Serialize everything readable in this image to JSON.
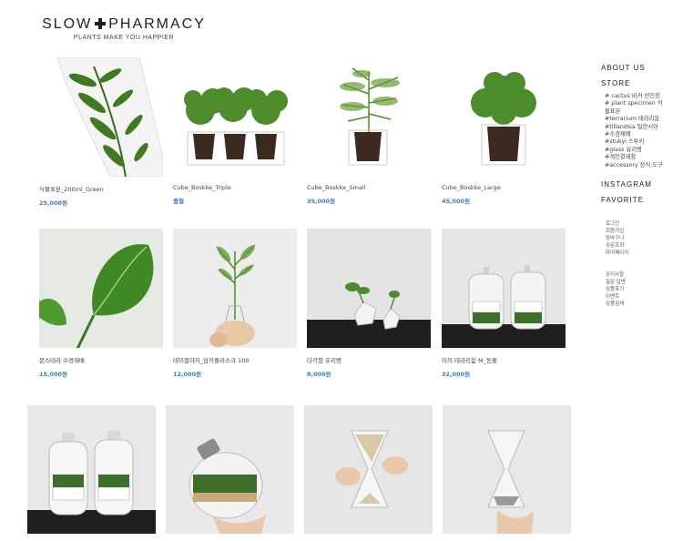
{
  "brand": {
    "name_left": "SLOW",
    "name_right": "PHARMACY",
    "tagline": "PLANTS MAKE YOU HAPPIER"
  },
  "products": [
    {
      "name": "식물표본_200ml_Green",
      "price": "25,000원"
    },
    {
      "name": "Cube_Boskke_Triple",
      "price": "품절"
    },
    {
      "name": "Cube_Boskke_Small",
      "price": "35,000원"
    },
    {
      "name": "Cube_Boskke_Large",
      "price": "45,000원"
    },
    {
      "name": "몬스테라 수경재배",
      "price": "15,000원"
    },
    {
      "name": "테이블야자_삼각플라스크 100",
      "price": "12,000원"
    },
    {
      "name": "다각형 유리병",
      "price": "8,000원"
    },
    {
      "name": "이끼 테라리움 M_동물",
      "price": "32,000원"
    }
  ],
  "sidebar": {
    "about": "ABOUT US",
    "store": "STORE",
    "categories": [
      "# cactus 비커 선인장",
      "# plant specimen 식",
      "물표본",
      "#terrarium 테라리움",
      "#tillandsia 틸란시아",
      "#수경재배",
      "#stukyi 스투키",
      "#glass 유리병",
      "#개인결제창",
      "#accessory 장식,도구"
    ],
    "instagram": "INSTAGRAM",
    "favorite": "FAVORITE",
    "links_a": [
      "로그인",
      "회원가입",
      "장바구니",
      "주문조회",
      "마이페이지"
    ],
    "links_b": [
      "공지사항",
      "질문 답변",
      "상품후기",
      "이벤트",
      "상품검색"
    ]
  }
}
